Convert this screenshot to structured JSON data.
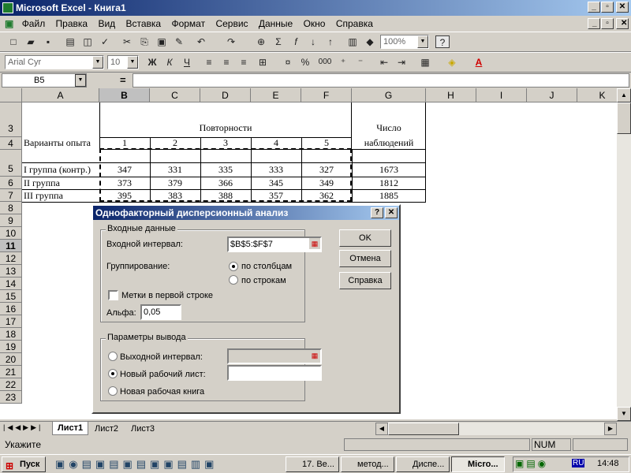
{
  "app": {
    "title": "Microsoft Excel - Книга1"
  },
  "menu": [
    "Файл",
    "Правка",
    "Вид",
    "Вставка",
    "Формат",
    "Сервис",
    "Данные",
    "Окно",
    "Справка"
  ],
  "toolbar": {
    "zoom": "100%",
    "font": "Arial Cyr",
    "size": "10",
    "bold": "Ж",
    "italic": "К",
    "underline": "Ч",
    "percent": "%",
    "thousands": "000"
  },
  "formula": {
    "namebox": "B5",
    "eq": "="
  },
  "columns": [
    "A",
    "B",
    "C",
    "D",
    "E",
    "F",
    "G",
    "H",
    "I",
    "J",
    "K"
  ],
  "rows": [
    "3",
    "4",
    "5",
    "6",
    "7",
    "8",
    "9",
    "10",
    "11",
    "12",
    "13",
    "14",
    "15",
    "16",
    "17",
    "18",
    "19",
    "20",
    "21",
    "22",
    "23"
  ],
  "sheet": {
    "povt": "Повторности",
    "chislo": "Число",
    "nabl": "наблюдений",
    "varianty": "Варианты опыта",
    "nums": [
      "1",
      "2",
      "3",
      "4",
      "5"
    ],
    "r1": [
      "I группа (контр.)",
      "347",
      "331",
      "335",
      "333",
      "327",
      "1673"
    ],
    "r2": [
      "II группа",
      "373",
      "379",
      "366",
      "345",
      "349",
      "1812"
    ],
    "r3": [
      "III группа",
      "395",
      "383",
      "388",
      "357",
      "362",
      "1885"
    ]
  },
  "tabs": [
    "Лист1",
    "Лист2",
    "Лист3"
  ],
  "status": {
    "text": "Укажите",
    "num": "NUM"
  },
  "dialog": {
    "title": "Однофакторный дисперсионный анализ",
    "input_group": "Входные данные",
    "input_range_label": "Входной интервал:",
    "input_range": "$B$5:$F$7",
    "grouping_label": "Группирование:",
    "by_columns": "по столбцам",
    "by_rows": "по строкам",
    "labels_first_row": "Метки в первой строке",
    "alpha_label": "Альфа:",
    "alpha": "0,05",
    "output_group": "Параметры вывода",
    "output_range": "Выходной интервал:",
    "new_sheet": "Новый рабочий лист:",
    "new_book": "Новая рабочая книга",
    "ok": "OK",
    "cancel": "Отмена",
    "help": "Справка"
  },
  "taskbar": {
    "start": "Пуск",
    "tasks": [
      "17. Be...",
      "метод...",
      "Диспе...",
      "Micro..."
    ],
    "clock": "14:48",
    "lang": "RU"
  }
}
